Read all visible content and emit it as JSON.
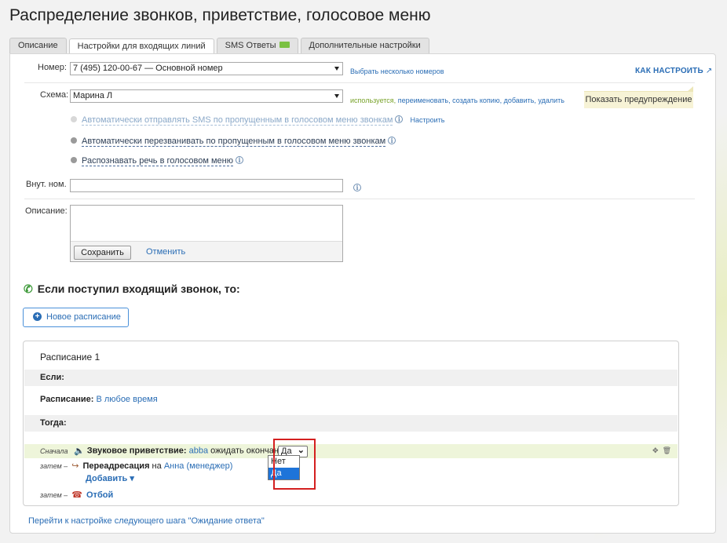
{
  "page": {
    "title": "Распределение звонков, приветствие, голосовое меню"
  },
  "tabs": [
    {
      "label": "Описание",
      "active": false
    },
    {
      "label": "Настройки для входящих линий",
      "active": true
    },
    {
      "label": "SMS Ответы",
      "active": false,
      "badge": "new"
    },
    {
      "label": "Дополнительные настройки",
      "active": false
    }
  ],
  "form": {
    "number_label": "Номер:",
    "number_value": "7 (495) 120-00-67 — Основной номер",
    "multi_numbers_link": "Выбрать несколько номеров",
    "howto_link": "КАК НАСТРОИТЬ",
    "scheme_label": "Схема:",
    "scheme_value": "Марина Л",
    "scheme_used": "используется,",
    "scheme_actions": "переименовать, создать копию, добавить, удалить",
    "warning_button": "Показать предупреждение",
    "opt_sms": "Автоматически отправлять SMS по пропущенным в голосовом меню звонкам",
    "opt_sms_setup": "Настроить",
    "opt_callback": "Автоматически перезванивать по пропущенным в голосовом меню звонкам",
    "opt_speech": "Распознавать речь в голосовом меню",
    "ext_label": "Внут. ном.",
    "ext_value": "",
    "desc_label": "Описание:",
    "desc_value": "",
    "save_button": "Сохранить",
    "cancel_link": "Отменить"
  },
  "incoming": {
    "title": "Если поступил входящий звонок, то:",
    "new_schedule_button": "Новое расписание"
  },
  "schedule": {
    "title": "Расписание 1",
    "if_label": "Если:",
    "schedule_label": "Расписание:",
    "schedule_value": "В любое время",
    "then_label": "Тогда:",
    "step1_prefix": "Сначала",
    "step1_name": "Звуковое приветствие:",
    "step1_file": "abba",
    "step1_wait": "ожидать окончания",
    "step1_select_value": "Да",
    "step1_options": [
      "Нет",
      "Да"
    ],
    "step2_prefix": "затем –",
    "step2_name": "Переадресация",
    "step2_on": "на",
    "step2_target": "Анна (менеджер)",
    "add_link": "Добавить ▾",
    "step3_prefix": "затем –",
    "step3_name": "Отбой"
  },
  "footer": {
    "next_step_link": "Перейти к настройке следующего шага \"Ожидание ответа\""
  }
}
